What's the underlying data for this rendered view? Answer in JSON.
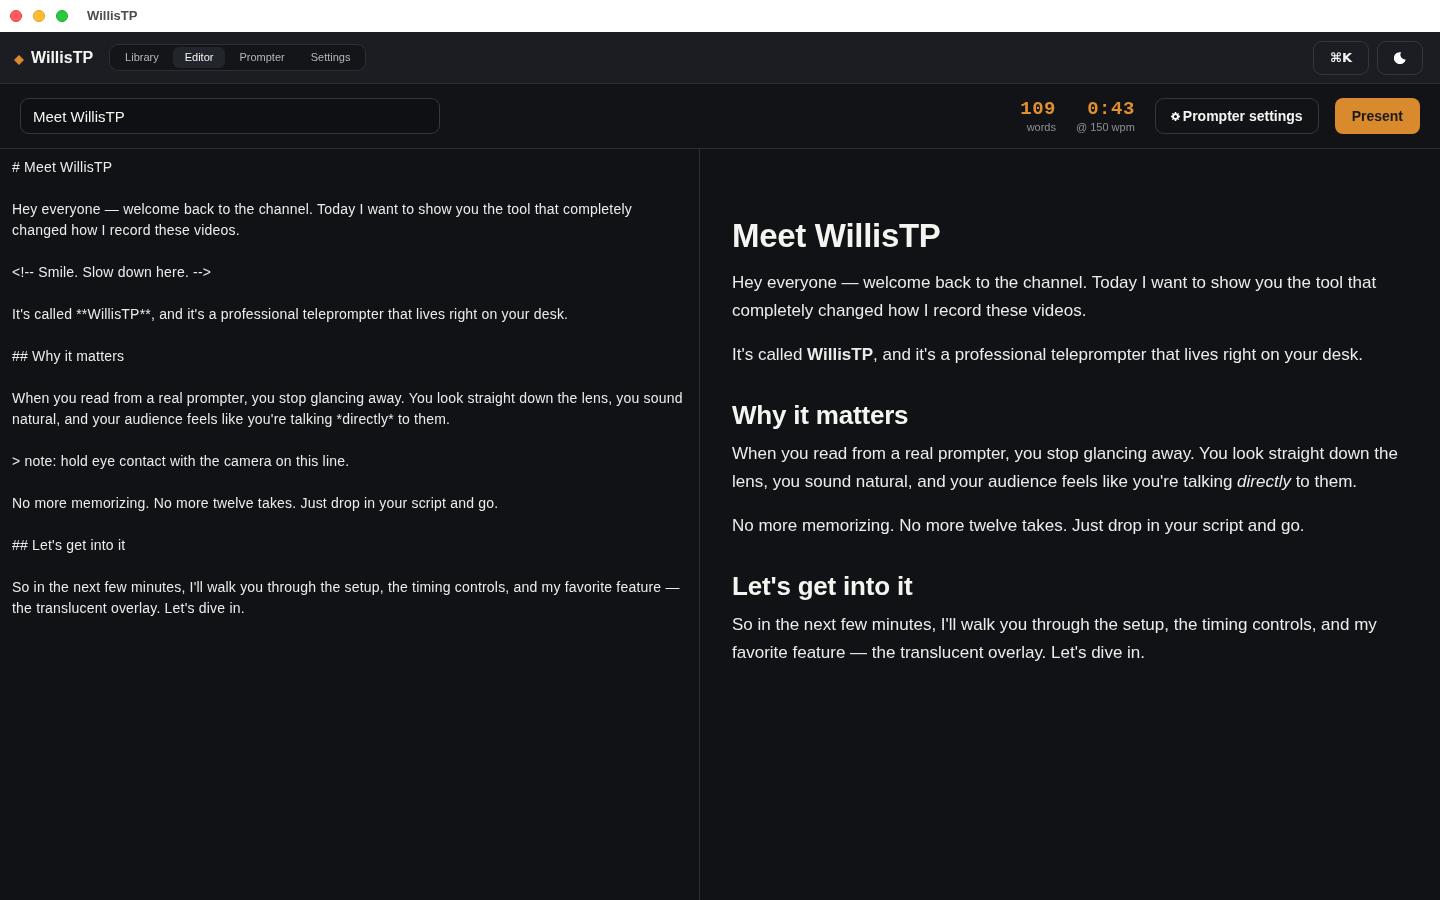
{
  "window": {
    "title": "WillisTP"
  },
  "app_bar": {
    "brand": "WillisTP",
    "tabs": [
      {
        "label": "Library",
        "selected": false
      },
      {
        "label": "Editor",
        "selected": true
      },
      {
        "label": "Prompter",
        "selected": false
      },
      {
        "label": "Settings",
        "selected": false
      }
    ],
    "command_button": "⌘K"
  },
  "document_bar": {
    "title_value": "Meet WillisTP",
    "stats": [
      {
        "value": "109",
        "label": "words"
      },
      {
        "value": "0:43",
        "label": "@ 150 wpm"
      }
    ],
    "settings_button": "Prompter settings",
    "present_button": "Present"
  },
  "editor": {
    "lines": [
      "# Meet WillisTP",
      "Hey everyone — welcome back to the channel. Today I want to show you the tool that completely changed how I record these videos.",
      "<!-- Smile. Slow down here. -->",
      "It's called **WillisTP**, and it's a professional teleprompter that lives right on your desk.",
      "## Why it matters",
      "When you read from a real prompter, you stop glancing away. You look straight down the lens, you sound natural, and your audience feels like you're talking *directly* to them.",
      "> note: hold eye contact with the camera on this line.",
      "No more memorizing. No more twelve takes. Just drop in your script and go.",
      "## Let's get into it",
      "So in the next few minutes, I'll walk you through the setup, the timing controls, and my favorite feature — the translucent overlay. Let's dive in."
    ]
  },
  "preview": {
    "blocks": [
      {
        "kind": "heading1",
        "text": "Meet WillisTP"
      },
      {
        "kind": "paragraph",
        "text": "Hey everyone — welcome back to the channel. Today I want to show you the tool that completely changed how I record these videos."
      },
      {
        "kind": "paragraph",
        "text": "It's called **WillisTP**, and it's a professional teleprompter that lives right on your desk."
      },
      {
        "kind": "heading2",
        "text": "Why it matters"
      },
      {
        "kind": "paragraph",
        "text": "When you read from a real prompter, you stop glancing away. You look straight down the lens, you sound natural, and your audience feels like you're talking *directly* to them."
      },
      {
        "kind": "paragraph",
        "text": "No more memorizing. No more twelve takes. Just drop in your script and go."
      },
      {
        "kind": "heading2",
        "text": "Let's get into it"
      },
      {
        "kind": "paragraph",
        "text": "So in the next few minutes, I'll walk you through the setup, the timing controls, and my favorite feature — the translucent overlay. Let's dive in."
      }
    ]
  }
}
